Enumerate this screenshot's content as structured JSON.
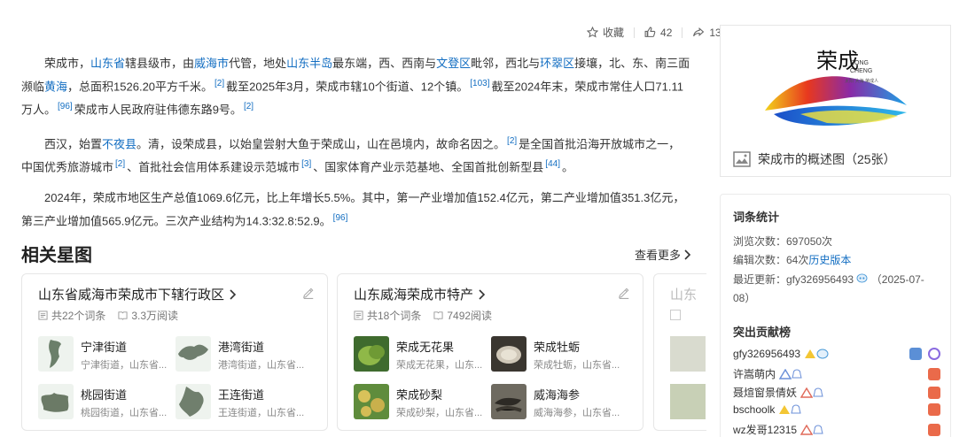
{
  "actions": {
    "collect_label": "收藏",
    "like_count": "42",
    "share_count": "13"
  },
  "article": {
    "p1": {
      "t1": "荣成市，",
      "l1": "山东省",
      "t2": "辖县级市，由",
      "l2": "威海市",
      "t3": "代管，地处",
      "l3": "山东半岛",
      "t4": "最东端，西、西南与",
      "l4": "文登区",
      "t5": "毗邻，西北与",
      "l5": "环翠区",
      "t6": "接壤，北、东、南三面濒临",
      "l6": "黄海",
      "t7": "，总面积1526.20平方千米。",
      "s1": "[2]",
      "t8": "截至2025年3月，荣成市辖10个街道、12个镇。",
      "s2": "[103]",
      "t9": "截至2024年末，荣成市常住人口71.11万人。",
      "s3": "[96]",
      "t10": "荣成市人民政府驻伟德东路9号。",
      "s4": "[2]"
    },
    "p2": {
      "t1": "西汉，始置",
      "l1": "不夜县",
      "t2": "。清，设荣成县，以始皇尝射大鱼于荣成山，山在邑境内，故命名因之。",
      "s1": "[2]",
      "t3": "是全国首批沿海开放城市之一，中国优秀旅游城市",
      "s2": "[2]",
      "t4": "、首批社会信用体系建设示范城市",
      "s3": "[3]",
      "t5": "、国家体育产业示范基地、全国首批创新型县",
      "s4": "[44]",
      "t6": "。"
    },
    "p3": {
      "t1": "2024年，荣成市地区生产总值1069.6亿元，比上年增长5.5%。其中，第一产业增加值152.4亿元，第二产业增加值351.3亿元，第三产业增加值565.9亿元。三次产业结构为14.3:32.8:52.9。",
      "s1": "[96]"
    }
  },
  "related": {
    "title": "相关星图",
    "more_label": "查看更多",
    "cards": [
      {
        "title": "山东省威海市荣成市下辖行政区",
        "count": "共22个词条",
        "reads": "3.3万阅读",
        "items": [
          {
            "name": "宁津街道",
            "desc": "宁津街道，山东省..."
          },
          {
            "name": "港湾街道",
            "desc": "港湾街道，山东省..."
          },
          {
            "name": "桃园街道",
            "desc": "桃园街道，山东省..."
          },
          {
            "name": "王连街道",
            "desc": "王连街道，山东省..."
          }
        ]
      },
      {
        "title": "山东威海荣成市特产",
        "count": "共18个词条",
        "reads": "7492阅读",
        "items": [
          {
            "name": "荣成无花果",
            "desc": "荣成无花果，山东..."
          },
          {
            "name": "荣成牡蛎",
            "desc": "荣成牡蛎，山东省..."
          },
          {
            "name": "荣成砂梨",
            "desc": "荣成砂梨，山东省..."
          },
          {
            "name": "威海海参",
            "desc": "威海海参，山东省..."
          }
        ]
      }
    ],
    "partial_title": "山东"
  },
  "sidebar": {
    "album_caption": "荣成市的概述图（25张）",
    "logo_text_cn": "荣成",
    "logo_text_en1": "RONG",
    "logo_text_en2": "CHENG",
    "logo_slogan": "太阳 大海 荣成人",
    "stats_title": "词条统计",
    "views": "浏览次数：697050次",
    "edits_prefix": "编辑次数：64次",
    "edits_link": "历史版本",
    "updated_prefix": "最近更新：gfy326956493",
    "updated_date": "（2025-07-",
    "updated_date2": "08）",
    "contrib_title": "突出贡献榜",
    "contributors": [
      "gfy326956493",
      "许嵩萌内",
      "聂煊窗景倩妖",
      "bschoolk",
      "wz发哥12315"
    ]
  }
}
